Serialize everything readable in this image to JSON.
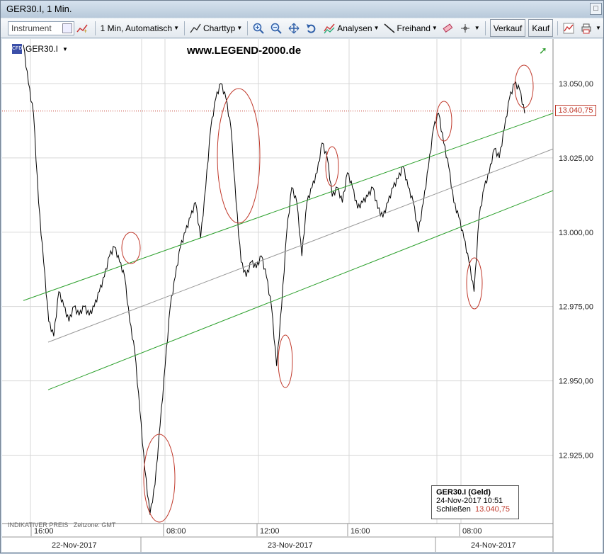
{
  "window": {
    "title": "GER30.I, 1 Min."
  },
  "toolbar": {
    "instrument_placeholder": "Instrument",
    "interval_label": "1 Min,  Automatisch",
    "charttype_label": "Charttyp",
    "analysen_label": "Analysen",
    "freihand_label": "Freihand",
    "verkauf_label": "Verkauf",
    "kauf_label": "Kauf"
  },
  "chart": {
    "symbol": "GER30.I",
    "watermark": "www.LEGEND-2000.de",
    "current_price_tag": "13.040,75",
    "indicative_label": "INDIKATIVER PREIS",
    "timezone_label": "Zeitzone: GMT",
    "colors": {
      "price_line": "#000000",
      "channel": "#2ca02c",
      "midline": "#999999",
      "highlight_ellipse": "#c0392b",
      "current_price_line": "#c0392b"
    }
  },
  "tooltip": {
    "title": "GER30.I (Geld)",
    "datetime": "24-Nov-2017 10:51",
    "close_label": "Schließen",
    "close_value": "13.040,75"
  },
  "chart_data": {
    "type": "line",
    "title": "GER30.I",
    "y_ticks": [
      "13.050,00",
      "13.025,00",
      "13.000,00",
      "12.975,00",
      "12.950,00",
      "12.925,00"
    ],
    "ylim": [
      12902,
      13065
    ],
    "x_ticks": [
      "16:00",
      "08:00",
      "12:00",
      "16:00",
      "08:00"
    ],
    "date_labels": [
      "22-Nov-2017",
      "23-Nov-2017",
      "24-Nov-2017"
    ],
    "series": [
      {
        "values": [
          13063,
          13050,
          13040,
          13010,
          12990,
          12970,
          12965,
          12980,
          12975,
          12970,
          12975,
          12972,
          12975,
          12972,
          12975,
          12980,
          12985,
          12992,
          12995,
          12990,
          12985,
          12970,
          12960,
          12940,
          12920,
          12905,
          12915,
          12935,
          12955,
          12975,
          12985,
          12995,
          13000,
          13005,
          13010,
          12998,
          13015,
          13035,
          13045,
          13050,
          13045,
          13035,
          13010,
          12990,
          12985,
          12990,
          12988,
          12992,
          12985,
          12975,
          12955,
          12975,
          13000,
          13015,
          13010,
          12992,
          13010,
          13015,
          13020,
          13030,
          13025,
          13012,
          13015,
          13010,
          13020,
          13015,
          13008,
          13010,
          13012,
          13015,
          13008,
          13005,
          13010,
          13015,
          13018,
          13022,
          13015,
          13010,
          13000,
          13010,
          13022,
          13035,
          13040,
          13030,
          13022,
          13010,
          13005,
          12998,
          12990,
          12980,
          13005,
          13015,
          13020,
          13028,
          13025,
          13035,
          13045,
          13050,
          13048,
          13040
        ]
      }
    ],
    "channel": {
      "upper": [
        12977,
        13040
      ],
      "middle": [
        12963,
        13028
      ],
      "lower": [
        12947,
        13014
      ]
    },
    "current_price": 13040.75,
    "grid": true,
    "legend": "none"
  }
}
